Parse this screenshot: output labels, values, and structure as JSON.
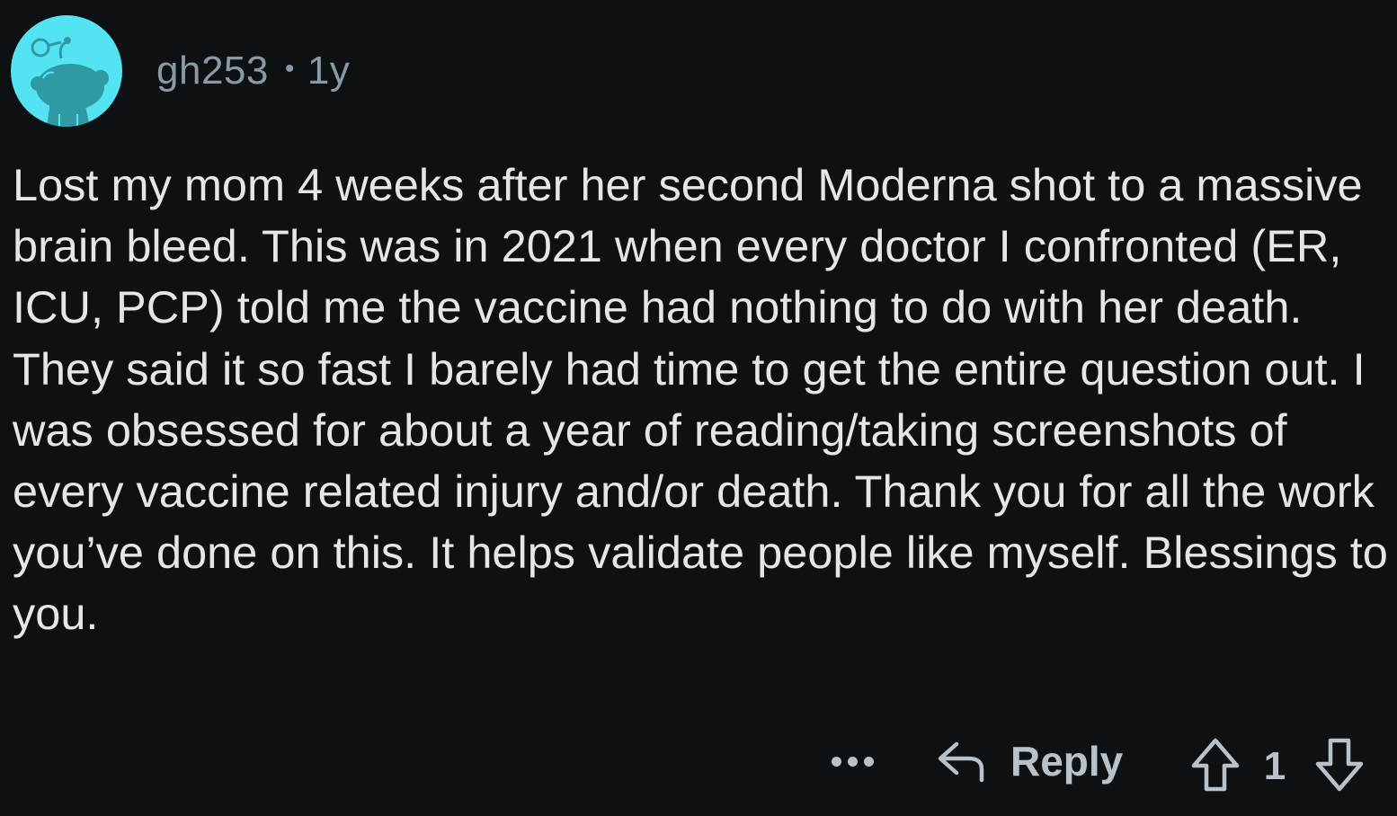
{
  "comment": {
    "username": "gh253",
    "separator": "•",
    "age": "1y",
    "body": "Lost my mom 4 weeks after her second Moderna shot to a massive brain bleed. This was in 2021 when every doctor I confronted (ER, ICU, PCP) told me the vaccine had nothing to do with her death. They said it so fast I barely had time to get the entire question out. I was obsessed for about a year of reading/taking screenshots of every vaccine related injury and/or death. Thank you for all the work you’ve done on this. It helps validate people like myself. Blessings to you."
  },
  "actions": {
    "more_icon": "more-horizontal-icon",
    "reply_icon": "reply-arrow-icon",
    "reply_label": "Reply",
    "upvote_icon": "upvote-arrow-icon",
    "score": "1",
    "downvote_icon": "downvote-arrow-icon"
  },
  "colors": {
    "background": "#0e1113",
    "avatar_bg": "#54e3f3",
    "avatar_figure": "#2f9aa3",
    "meta_text": "#8a99a2",
    "body_text": "#e4e7ea",
    "action_text": "#b9c2c8"
  }
}
